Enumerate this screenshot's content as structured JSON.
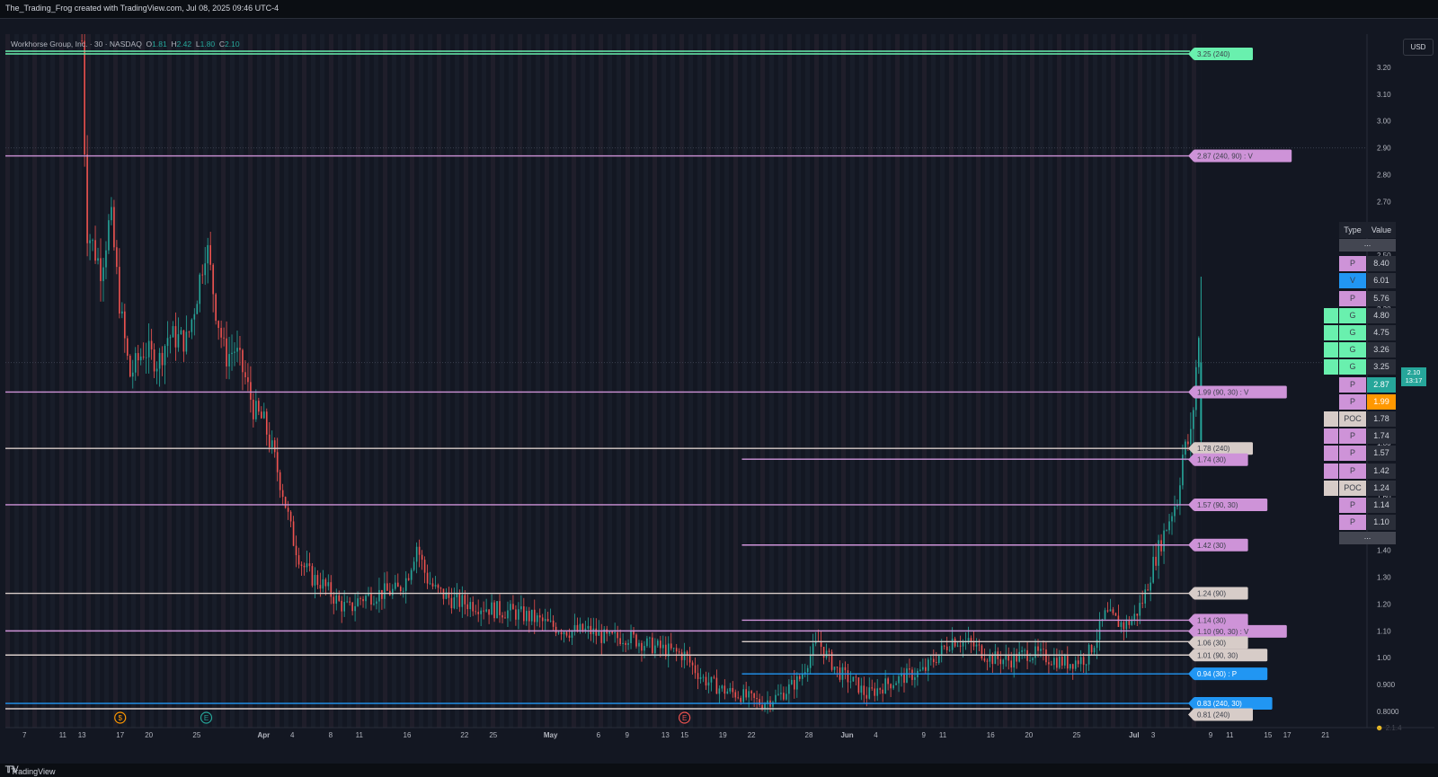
{
  "header": {
    "title": "The_Trading_Frog created with TradingView.com, Jul 08, 2025 09:46 UTC-4"
  },
  "symbol": {
    "name": "Workhorse Group, Inc. · 30 · NASDAQ",
    "o_label": "O",
    "o": "1.81",
    "h_label": "H",
    "h": "2.42",
    "l_label": "L",
    "l": "1.80",
    "c_label": "C",
    "c": "2.10"
  },
  "currency": "USD",
  "current_price": {
    "price": "2.10",
    "countdown": "13:17"
  },
  "footer": {
    "brand": "TradingView"
  },
  "version_badge": "2.1.4",
  "colors": {
    "purple": "#ce93d8",
    "green": "#69f0ae",
    "blue": "#2196f3",
    "beige": "#d7ccc8",
    "orange": "#ff9800",
    "up": "#26a69a",
    "down": "#ef5350"
  },
  "levels_table": {
    "headers": [
      "Type",
      "Value"
    ],
    "rows": [
      {
        "type": "...",
        "value": "",
        "color": "#434651"
      },
      {
        "type": "P",
        "value": "8.40",
        "color": "#ce93d8"
      },
      {
        "type": "V",
        "value": "6.01",
        "color": "#2196f3"
      },
      {
        "type": "P",
        "value": "5.76",
        "color": "#ce93d8"
      },
      {
        "type": "G",
        "value": "4.80",
        "color": "#69f0ae",
        "flag": true
      },
      {
        "type": "G",
        "value": "4.75",
        "color": "#69f0ae",
        "flag": true
      },
      {
        "type": "G",
        "value": "3.26",
        "color": "#69f0ae",
        "flag": true
      },
      {
        "type": "G",
        "value": "3.25",
        "color": "#69f0ae",
        "flag": true
      },
      {
        "type": "P",
        "value": "2.87",
        "color": "#ce93d8",
        "valcolor": "#26a69a"
      },
      {
        "type": "P",
        "value": "1.99",
        "color": "#ce93d8",
        "valcolor": "#ff9800"
      },
      {
        "type": "POC",
        "value": "1.78",
        "color": "#d7ccc8",
        "flag": true
      },
      {
        "type": "P",
        "value": "1.74",
        "color": "#ce93d8",
        "flag": true
      },
      {
        "type": "P",
        "value": "1.57",
        "color": "#ce93d8",
        "flag": true
      },
      {
        "type": "P",
        "value": "1.42",
        "color": "#ce93d8",
        "flag": true
      },
      {
        "type": "POC",
        "value": "1.24",
        "color": "#d7ccc8",
        "flag": true
      },
      {
        "type": "P",
        "value": "1.14",
        "color": "#ce93d8"
      },
      {
        "type": "P",
        "value": "1.10",
        "color": "#ce93d8"
      },
      {
        "type": "...",
        "value": "",
        "color": "#434651"
      }
    ]
  },
  "chart_data": {
    "type": "candlestick",
    "title": "",
    "ylim": [
      0.78,
      3.34
    ],
    "grid": false,
    "y_ticks": [
      "3.20",
      "3.10",
      "3.00",
      "2.90",
      "2.80",
      "2.70",
      "2.60",
      "2.50",
      "2.40",
      "2.30",
      "2.20",
      "2.10",
      "2.00",
      "1.90",
      "1.80",
      "1.70",
      "1.60",
      "1.50",
      "1.40",
      "1.30",
      "1.20",
      "1.10",
      "1.00",
      "0.900",
      "0.8000"
    ],
    "x_ticks": [
      {
        "label": "7",
        "d": 7
      },
      {
        "label": "11",
        "d": 11
      },
      {
        "label": "13",
        "d": 13
      },
      {
        "label": "17",
        "d": 17
      },
      {
        "label": "20",
        "d": 20
      },
      {
        "label": "25",
        "d": 25
      },
      {
        "label": "Apr",
        "d": 32,
        "bold": true
      },
      {
        "label": "4",
        "d": 35
      },
      {
        "label": "8",
        "d": 39
      },
      {
        "label": "11",
        "d": 42
      },
      {
        "label": "16",
        "d": 47
      },
      {
        "label": "22",
        "d": 53
      },
      {
        "label": "25",
        "d": 56
      },
      {
        "label": "May",
        "d": 62,
        "bold": true
      },
      {
        "label": "6",
        "d": 67
      },
      {
        "label": "9",
        "d": 70
      },
      {
        "label": "13",
        "d": 74
      },
      {
        "label": "15",
        "d": 76
      },
      {
        "label": "19",
        "d": 80
      },
      {
        "label": "22",
        "d": 83
      },
      {
        "label": "28",
        "d": 89
      },
      {
        "label": "Jun",
        "d": 93,
        "bold": true
      },
      {
        "label": "4",
        "d": 96
      },
      {
        "label": "9",
        "d": 101
      },
      {
        "label": "11",
        "d": 103
      },
      {
        "label": "16",
        "d": 108
      },
      {
        "label": "20",
        "d": 112
      },
      {
        "label": "25",
        "d": 117
      },
      {
        "label": "Jul",
        "d": 123,
        "bold": true
      },
      {
        "label": "3",
        "d": 125
      },
      {
        "label": "9",
        "d": 131
      },
      {
        "label": "11",
        "d": 133
      },
      {
        "label": "15",
        "d": 137
      },
      {
        "label": "17",
        "d": 139
      },
      {
        "label": "21",
        "d": 143
      }
    ],
    "x_range": [
      5,
      145
    ],
    "last_bar_day": 130,
    "events": [
      {
        "label": "$",
        "d": 17,
        "color": "#ff9800"
      },
      {
        "label": "E",
        "d": 26,
        "color": "#26a69a"
      },
      {
        "label": "E",
        "d": 76,
        "color": "#ef5350"
      }
    ],
    "price_path": [
      [
        13,
        3.3
      ],
      [
        13.5,
        2.6
      ],
      [
        15,
        2.45
      ],
      [
        16,
        2.65
      ],
      [
        17,
        2.3
      ],
      [
        18,
        2.05
      ],
      [
        19.5,
        2.15
      ],
      [
        21,
        2.1
      ],
      [
        22,
        2.2
      ],
      [
        24,
        2.18
      ],
      [
        25,
        2.35
      ],
      [
        26,
        2.55
      ],
      [
        27,
        2.3
      ],
      [
        28,
        2.12
      ],
      [
        29,
        2.15
      ],
      [
        30,
        2.05
      ],
      [
        31,
        1.92
      ],
      [
        32,
        1.88
      ],
      [
        33,
        1.76
      ],
      [
        34,
        1.62
      ],
      [
        35,
        1.45
      ],
      [
        36,
        1.35
      ],
      [
        37,
        1.3
      ],
      [
        38,
        1.28
      ],
      [
        39,
        1.24
      ],
      [
        40,
        1.2
      ],
      [
        41,
        1.18
      ],
      [
        42,
        1.22
      ],
      [
        44,
        1.24
      ],
      [
        46,
        1.25
      ],
      [
        47,
        1.3
      ],
      [
        48,
        1.42
      ],
      [
        49,
        1.3
      ],
      [
        50,
        1.25
      ],
      [
        52,
        1.21
      ],
      [
        54,
        1.2
      ],
      [
        56,
        1.18
      ],
      [
        58,
        1.17
      ],
      [
        60,
        1.15
      ],
      [
        62,
        1.12
      ],
      [
        64,
        1.1
      ],
      [
        66,
        1.1
      ],
      [
        68,
        1.07
      ],
      [
        70,
        1.08
      ],
      [
        72,
        1.05
      ],
      [
        74,
        1.03
      ],
      [
        76,
        1.01
      ],
      [
        77,
        0.96
      ],
      [
        78,
        0.92
      ],
      [
        80,
        0.88
      ],
      [
        82,
        0.86
      ],
      [
        84,
        0.83
      ],
      [
        86,
        0.86
      ],
      [
        88,
        0.92
      ],
      [
        89,
        1.0
      ],
      [
        90,
        1.06
      ],
      [
        91,
        1.0
      ],
      [
        92,
        0.95
      ],
      [
        94,
        0.9
      ],
      [
        95,
        0.86
      ],
      [
        97,
        0.9
      ],
      [
        99,
        0.93
      ],
      [
        101,
        0.95
      ],
      [
        103,
        1.03
      ],
      [
        104,
        1.07
      ],
      [
        106,
        1.05
      ],
      [
        108,
        1.0
      ],
      [
        110,
        0.99
      ],
      [
        112,
        1.02
      ],
      [
        114,
        1.0
      ],
      [
        116,
        0.98
      ],
      [
        118,
        1.0
      ],
      [
        119,
        1.07
      ],
      [
        120,
        1.16
      ],
      [
        121,
        1.14
      ],
      [
        122,
        1.12
      ],
      [
        123,
        1.15
      ],
      [
        124,
        1.22
      ],
      [
        125,
        1.35
      ],
      [
        126,
        1.45
      ],
      [
        127,
        1.55
      ],
      [
        127.6,
        1.6
      ],
      [
        128,
        1.75
      ],
      [
        129,
        1.83
      ],
      [
        129.7,
        2.2
      ],
      [
        130,
        2.1
      ]
    ],
    "levels": [
      {
        "label": "3.25 (240)",
        "price": 3.25,
        "color": "#69f0ae",
        "from_d": 5
      },
      {
        "label": "3.26",
        "price": 3.26,
        "color": "#69f0ae",
        "from_d": 5,
        "hide_label": true
      },
      {
        "label": "2.87 (240, 90) : V",
        "price": 2.87,
        "color": "#ce93d8",
        "from_d": 5
      },
      {
        "label": "1.99 (90, 30) : V",
        "price": 1.99,
        "color": "#ce93d8",
        "from_d": 5
      },
      {
        "label": "1.78 (240)",
        "price": 1.78,
        "color": "#d7ccc8",
        "from_d": 5
      },
      {
        "label": "1.74 (30)",
        "price": 1.74,
        "color": "#ce93d8",
        "from_d": 82
      },
      {
        "label": "1.57 (90, 30)",
        "price": 1.57,
        "color": "#ce93d8",
        "from_d": 5
      },
      {
        "label": "1.42 (30)",
        "price": 1.42,
        "color": "#ce93d8",
        "from_d": 82
      },
      {
        "label": "1.24 (90)",
        "price": 1.24,
        "color": "#d7ccc8",
        "from_d": 5
      },
      {
        "label": "1.14 (30)",
        "price": 1.14,
        "color": "#ce93d8",
        "from_d": 82
      },
      {
        "label": "1.10 (90, 30) : V",
        "price": 1.1,
        "color": "#ce93d8",
        "from_d": 5
      },
      {
        "label": "1.06 (30)",
        "price": 1.06,
        "color": "#d7ccc8",
        "from_d": 82
      },
      {
        "label": "1.01 (90, 30)",
        "price": 1.01,
        "color": "#d7ccc8",
        "from_d": 5
      },
      {
        "label": "0.94 (30) : P",
        "price": 0.94,
        "color": "#2196f3",
        "from_d": 82
      },
      {
        "label": "0.83 (240, 30)",
        "price": 0.83,
        "color": "#2196f3",
        "from_d": 5
      },
      {
        "label": "0.81 (240)",
        "price": 0.81,
        "color": "#d7ccc8",
        "from_d": 5
      }
    ]
  }
}
